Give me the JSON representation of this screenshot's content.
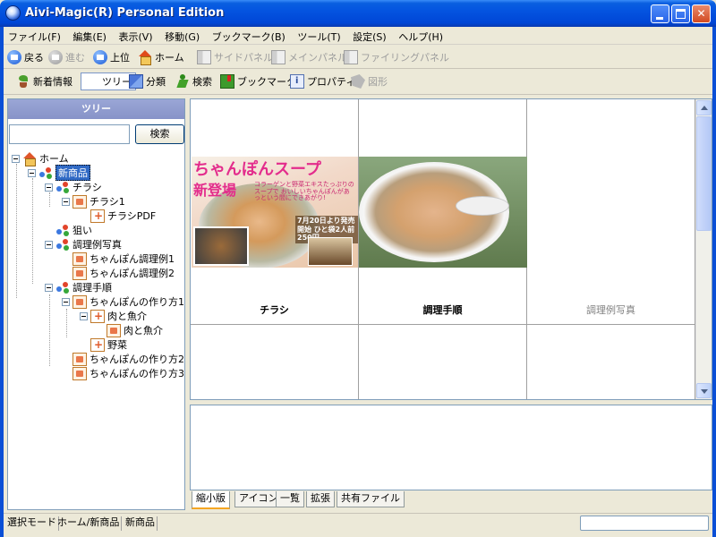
{
  "window": {
    "title": "Aivi-Magic(R) Personal Edition"
  },
  "menu": [
    "ファイル(F)",
    "編集(E)",
    "表示(V)",
    "移動(G)",
    "ブックマーク(B)",
    "ツール(T)",
    "設定(S)",
    "ヘルプ(H)"
  ],
  "toolbar_nav": {
    "back": "戻る",
    "forward": "進む",
    "up": "上位",
    "home": "ホーム",
    "side_panel": "サイドパネル",
    "main_panel": "メインパネル",
    "filing_panel": "ファイリングパネル"
  },
  "toolbar_view": {
    "new_info": "新着情報",
    "tree": "ツリー",
    "category": "分類",
    "search": "検索",
    "bookmark": "ブックマーク",
    "property": "プロパティ",
    "shape": "図形"
  },
  "left_panel": {
    "header": "ツリー",
    "search_value": "",
    "search_button": "検索"
  },
  "tree": {
    "home": "ホーム",
    "new_product": "新商品",
    "flyer": "チラシ",
    "flyer1": "チラシ1",
    "flyer_pdf": "チラシPDF",
    "aim": "狙い",
    "recipe_photos": "調理例写真",
    "recipe_example1": "ちゃんぽん調理例1",
    "recipe_example2": "ちゃんぽん調理例2",
    "cooking_steps": "調理手順",
    "howto1": "ちゃんぽんの作り方1",
    "meat_fish": "肉と魚介",
    "meat_fish_child": "肉と魚介",
    "vegetables": "野菜",
    "howto2": "ちゃんぽんの作り方2",
    "howto3": "ちゃんぽんの作り方3"
  },
  "grid": {
    "cells": [
      {
        "label": "チラシ"
      },
      {
        "label": "調理手順"
      },
      {
        "label": "調理例写真"
      }
    ],
    "flyer_thumb": {
      "heading1": "ちゃんぽんスープ",
      "heading2": "新登場",
      "note": "コラーゲンと野菜エキスたっぷりのスープで おいしいちゃんぽんがあっという間にできあがり!",
      "release": "7月20日より発売開始 ひと袋2人前250円"
    }
  },
  "tabs": [
    "縮小版",
    "アイコン",
    "一覧",
    "拡張",
    "共有ファイル"
  ],
  "status": {
    "mode": "選択モード",
    "path": "ホーム/新商品",
    "current": "新商品"
  }
}
